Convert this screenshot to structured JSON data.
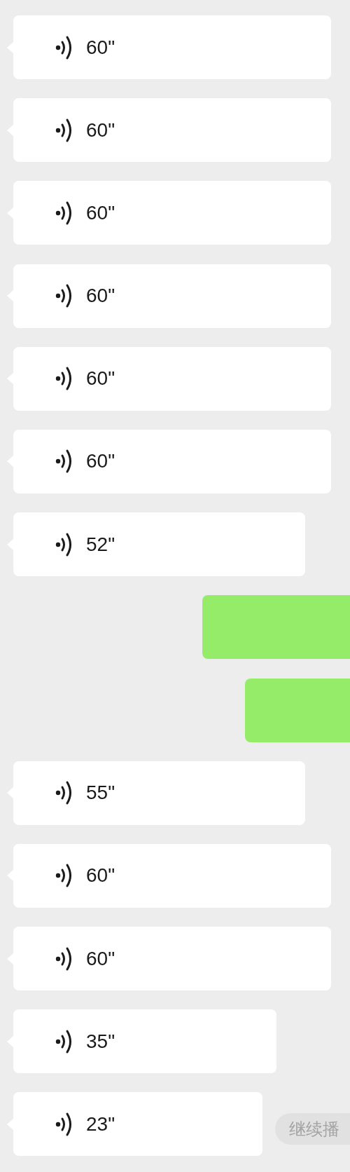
{
  "messages": [
    {
      "kind": "voice",
      "duration": "60\""
    },
    {
      "kind": "voice",
      "duration": "60\""
    },
    {
      "kind": "voice",
      "duration": "60\""
    },
    {
      "kind": "voice",
      "duration": "60\""
    },
    {
      "kind": "voice",
      "duration": "60\""
    },
    {
      "kind": "voice",
      "duration": "60\""
    },
    {
      "kind": "voice",
      "duration": "52\""
    },
    {
      "kind": "outgoing"
    },
    {
      "kind": "outgoing"
    },
    {
      "kind": "voice",
      "duration": "55\""
    },
    {
      "kind": "voice",
      "duration": "60\""
    },
    {
      "kind": "voice",
      "duration": "60\""
    },
    {
      "kind": "voice",
      "duration": "35\""
    },
    {
      "kind": "voice",
      "duration": "23\""
    }
  ],
  "resume_button": {
    "label": "继续播"
  }
}
